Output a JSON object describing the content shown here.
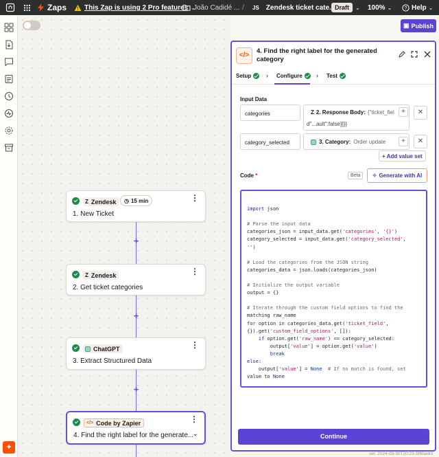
{
  "topbar": {
    "app_name": "Zaps",
    "pro_notice": "This Zap is using 2 Pro features",
    "owner": "João Cadidé ...",
    "code_badge": "JS",
    "zap_title": "Zendesk ticket cate...",
    "status": "Draft",
    "zoom": "100%",
    "help": "Help"
  },
  "toolbar": {
    "publish_label": "Publish"
  },
  "steps": [
    {
      "app": "Zendesk",
      "title": "1. New Ticket",
      "badge": "15 min"
    },
    {
      "app": "Zendesk",
      "title": "2. Get ticket categories"
    },
    {
      "app": "ChatGPT",
      "title": "3. Extract Structured Data"
    },
    {
      "app": "Code by Zapier",
      "title": "4. Find the right label for the generate..."
    }
  ],
  "panel": {
    "title": "4. Find the right label for the generated category",
    "tabs": [
      "Setup",
      "Configure",
      "Test"
    ],
    "input_data_label": "Input Data",
    "inputs": [
      {
        "key": "categories",
        "step": "2. Response Body:",
        "preview": "{\"ticket_fiel",
        "preview2": "d\"...ault\":false}]}}"
      },
      {
        "key": "category_selected",
        "step": "3. Category:",
        "preview": "Order update"
      }
    ],
    "add_value_set": "Add value set",
    "code_label": "Code",
    "required_mark": "*",
    "beta": "Beta",
    "generate_ai": "Generate with AI",
    "continue": "Continue",
    "version": "ver. 2024-09-30T20:23-5f6fae83"
  },
  "code_lines": [
    "",
    "import json",
    "",
    "# Parse the input data",
    "categories_json = input_data.get('categories', '{}')",
    "category_selected = input_data.get('category_selected',",
    "'')",
    "",
    "# Load the categories from the JSON string",
    "categories_data = json.loads(categories_json)",
    "",
    "# Initialize the output variable",
    "output = {}",
    "",
    "# Iterate through the custom field options to find the",
    "matching raw_name",
    "for option in categories_data.get('ticket_field',",
    "{}).get('custom_field_options', []):",
    "    if option.get('raw_name') == category_selected:",
    "        output['value'] = option.get('value')",
    "        break",
    "else:",
    "    output['value'] = None  # If no match is found, set",
    "value to None"
  ],
  "colors": {
    "accent": "#5b43d6",
    "success": "#1c8a4a",
    "brand": "#ff4f00"
  }
}
